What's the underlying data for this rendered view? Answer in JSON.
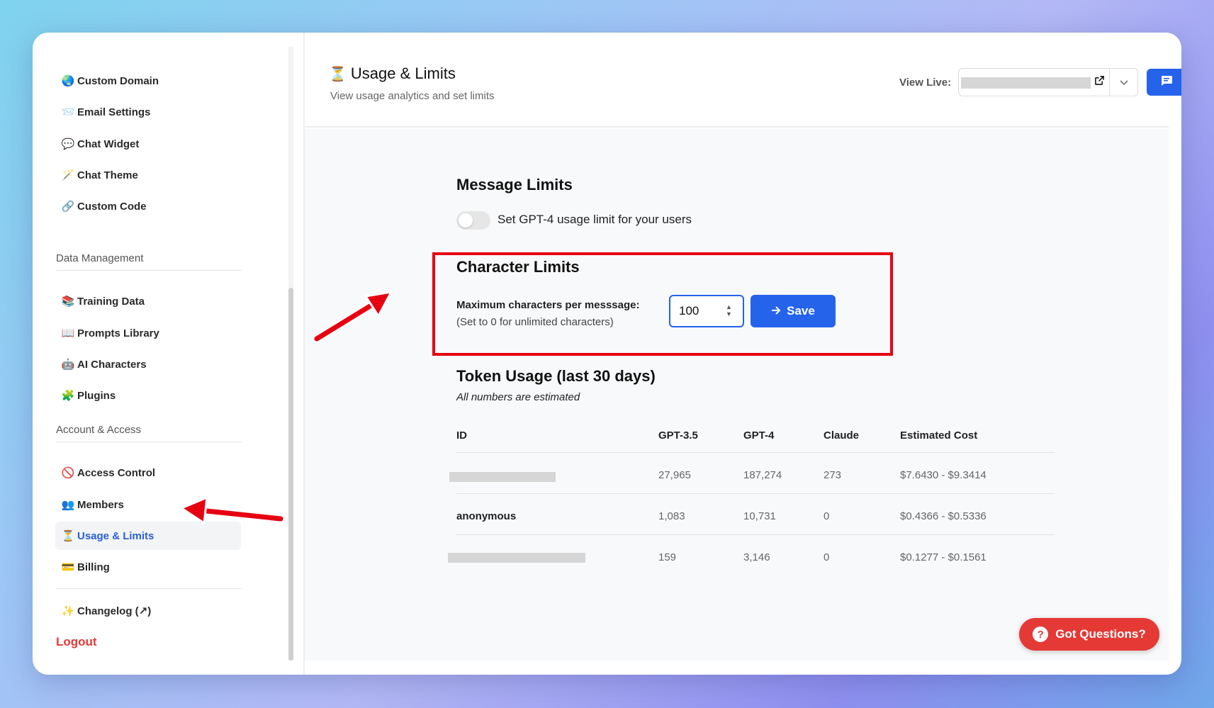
{
  "sidebar": {
    "items_top": [
      {
        "icon": "🌏",
        "label": "Custom Domain"
      },
      {
        "icon": "📨",
        "label": "Email Settings"
      },
      {
        "icon": "💬",
        "label": "Chat Widget"
      },
      {
        "icon": "🪄",
        "label": "Chat Theme"
      },
      {
        "icon": "🔗",
        "label": "Custom Code"
      }
    ],
    "section_data": "Data Management",
    "items_data": [
      {
        "icon": "📚",
        "label": "Training Data"
      },
      {
        "icon": "📖",
        "label": "Prompts Library"
      },
      {
        "icon": "🤖",
        "label": "AI Characters"
      },
      {
        "icon": "🧩",
        "label": "Plugins"
      }
    ],
    "section_account": "Account & Access",
    "items_account": [
      {
        "icon": "🚫",
        "label": "Access Control"
      },
      {
        "icon": "👥",
        "label": "Members"
      },
      {
        "icon": "⏳",
        "label": "Usage & Limits"
      },
      {
        "icon": "💳",
        "label": "Billing"
      }
    ],
    "changelog": {
      "icon": "✨",
      "label": "Changelog (↗)"
    },
    "logout": "Logout"
  },
  "header": {
    "icon": "⏳",
    "title": "Usage & Limits",
    "subtitle": "View usage analytics and set limits",
    "view_live_label": "View Live:"
  },
  "message_limits": {
    "title": "Message Limits",
    "toggle_label": "Set GPT-4 usage limit for your users"
  },
  "character_limits": {
    "title": "Character Limits",
    "label": "Maximum characters per messsage:",
    "hint": "(Set to 0 for unlimited characters)",
    "value": "100",
    "save_label": "Save"
  },
  "token_usage": {
    "title": "Token Usage (last 30 days)",
    "note": "All numbers are estimated",
    "columns": [
      "ID",
      "GPT-3.5",
      "GPT-4",
      "Claude",
      "Estimated Cost"
    ],
    "rows": [
      {
        "id": "",
        "gpt35": "27,965",
        "gpt4": "187,274",
        "claude": "273",
        "cost": "$7.6430 - $9.3414"
      },
      {
        "id": "anonymous",
        "gpt35": "1,083",
        "gpt4": "10,731",
        "claude": "0",
        "cost": "$0.4366 - $0.5336"
      },
      {
        "id": "",
        "gpt35": "159",
        "gpt4": "3,146",
        "claude": "0",
        "cost": "$0.1277 - $0.1561"
      }
    ]
  },
  "help_button": "Got Questions?",
  "colors": {
    "accent": "#2563eb",
    "danger": "#e53935",
    "highlight": "#e60012"
  }
}
